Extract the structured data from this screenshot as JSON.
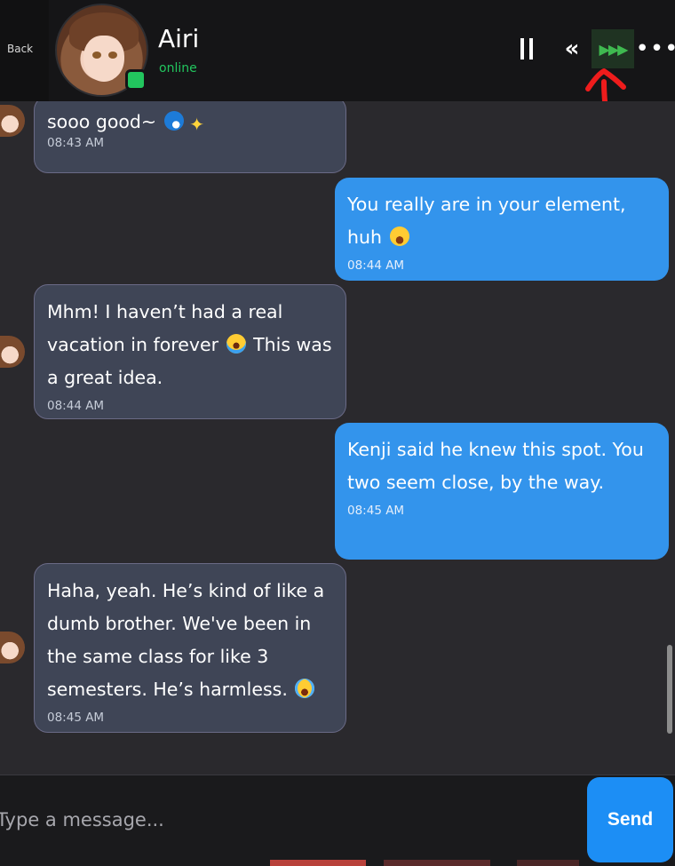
{
  "header": {
    "back_label": "Back",
    "contact_name": "Airi",
    "contact_status": "online"
  },
  "controls": {
    "pause_icon": "pause-icon",
    "rewind_icon": "rewind-icon",
    "fast_forward_icon": "fast-forward-icon",
    "more_icon": "more-icon",
    "fast_forward_active_color": "#3fb950"
  },
  "messages": [
    {
      "direction": "in",
      "text": "sooo good~",
      "emojis": [
        "wave",
        "sparkles"
      ],
      "time": "08:43 AM"
    },
    {
      "direction": "out",
      "text": "You really are in your element, huh",
      "emojis": [
        "grin"
      ],
      "time": "08:44 AM"
    },
    {
      "direction": "in",
      "text_a": "Mhm! I haven’t had a real vacation in forever",
      "text_b": "This was a great idea.",
      "emojis": [
        "crying"
      ],
      "time": "08:44 AM"
    },
    {
      "direction": "out",
      "text": "Kenji said he knew this spot. You two seem close, by the way.",
      "time": "08:45 AM"
    },
    {
      "direction": "in",
      "text": "Haha, yeah. He’s kind of like a dumb brother. We've been in the same class for like 3 semesters. He’s harmless.",
      "emojis": [
        "tears-of-joy"
      ],
      "time": "08:45 AM"
    }
  ],
  "composer": {
    "placeholder": "Type a message...",
    "send_label": "Send"
  },
  "colors": {
    "outgoing_bubble": "#3394ec",
    "incoming_bubble": "#3f4556",
    "online": "#22c55e",
    "send_button": "#1c8ef5",
    "annotation_arrow": "#ee1c1c"
  }
}
